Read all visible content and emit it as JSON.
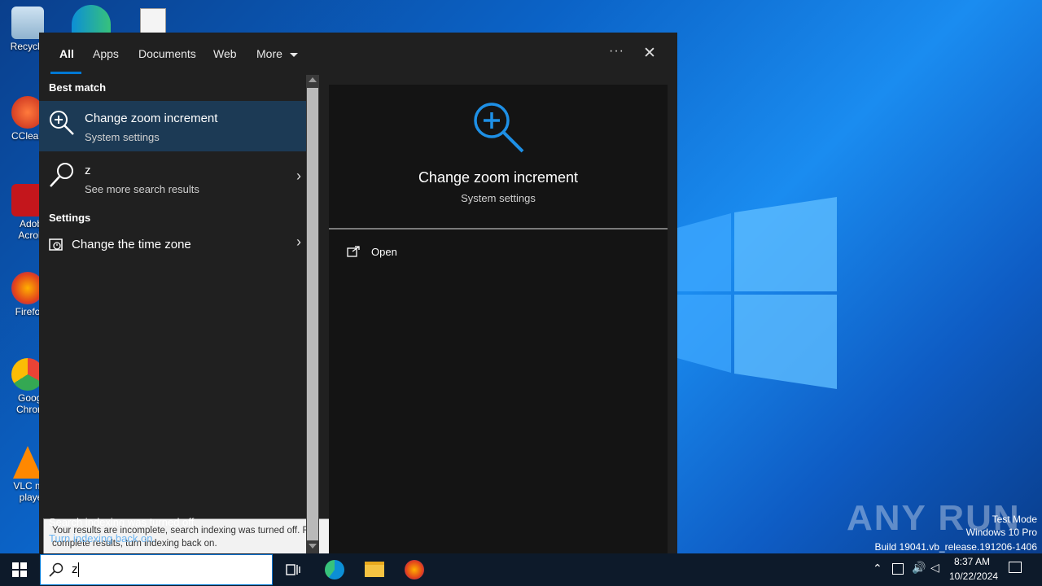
{
  "colors": {
    "accent": "#0078d4",
    "panel_bg": "#202020",
    "selected_bg": "#1c3a55",
    "preview_bg": "#141414",
    "taskbar_bg": "#0d1a2a"
  },
  "desktop": {
    "icons": [
      {
        "label": "Recycle",
        "icon": "recycle-bin-icon"
      },
      {
        "label": "CClean",
        "icon": "ccleaner-icon"
      },
      {
        "label": "Adob Acrob",
        "icon": "adobe-acrobat-icon"
      },
      {
        "label": "Firefo",
        "icon": "firefox-icon"
      },
      {
        "label": "Googl Chrom",
        "icon": "chrome-icon"
      },
      {
        "label": "VLC me playe",
        "icon": "vlc-icon"
      }
    ]
  },
  "search_panel": {
    "tabs": [
      "All",
      "Apps",
      "Documents",
      "Web",
      "More"
    ],
    "active_tab": "All",
    "more_options_label": "···",
    "close_label": "✕",
    "best_match_heading": "Best match",
    "best_match": {
      "title": "Change zoom increment",
      "subtitle": "System settings",
      "icon": "zoom-in-icon"
    },
    "web_result": {
      "title": "z",
      "subtitle": "See more search results",
      "icon": "search-icon"
    },
    "settings_heading": "Settings",
    "settings_result": {
      "title": "Change the time zone",
      "icon": "clock-settings-icon"
    },
    "tooltip": "Your results are incomplete, search indexing was turned off. For complete results, turn indexing back on.",
    "indexing_status": "Search indexing was turned off.",
    "indexing_link": "Turn indexing back on.",
    "preview": {
      "title": "Change zoom increment",
      "subtitle": "System settings",
      "action_open": "Open"
    }
  },
  "taskbar": {
    "search_value": "z",
    "time": "8:37 AM",
    "date": "10/22/2024"
  },
  "watermark": {
    "brand": "ANY RUN",
    "line1": "Test Mode",
    "line2": "Windows 10 Pro",
    "line3": "Build 19041.vb_release.191206-1406"
  }
}
